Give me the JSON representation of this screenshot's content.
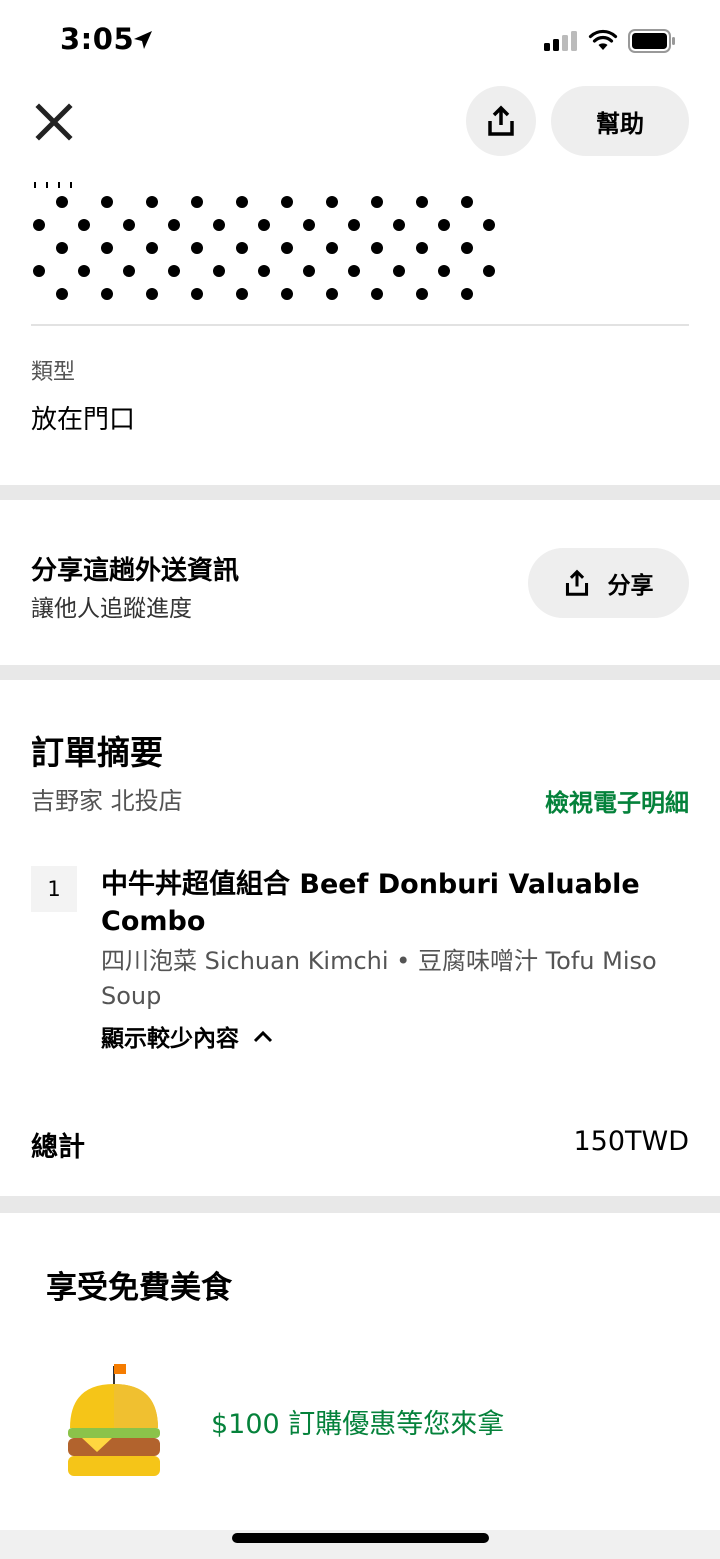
{
  "status_bar": {
    "time": "3:05"
  },
  "nav": {
    "help_label": "幫助"
  },
  "delivery_type": {
    "label": "類型",
    "value": "放在門口"
  },
  "share_section": {
    "title": "分享這趟外送資訊",
    "subtitle": "讓他人追蹤進度",
    "button_label": "分享"
  },
  "order_summary": {
    "title": "訂單摘要",
    "store": "吉野家 北投店",
    "receipt_link": "檢視電子明細",
    "item": {
      "quantity": "1",
      "name": "中牛丼超值組合 Beef Donburi Valuable Combo",
      "options": "四川泡菜 Sichuan Kimchi • 豆腐味噌汁 Tofu Miso Soup",
      "toggle_label": "顯示較少內容"
    },
    "total_label": "總計",
    "total_value": "150TWD"
  },
  "promo": {
    "title": "享受免費美食",
    "text": "$100 訂購優惠等您來拿"
  },
  "colors": {
    "accent_green": "#05823b",
    "button_bg": "#eeeeee",
    "band": "#e8e8e8"
  }
}
